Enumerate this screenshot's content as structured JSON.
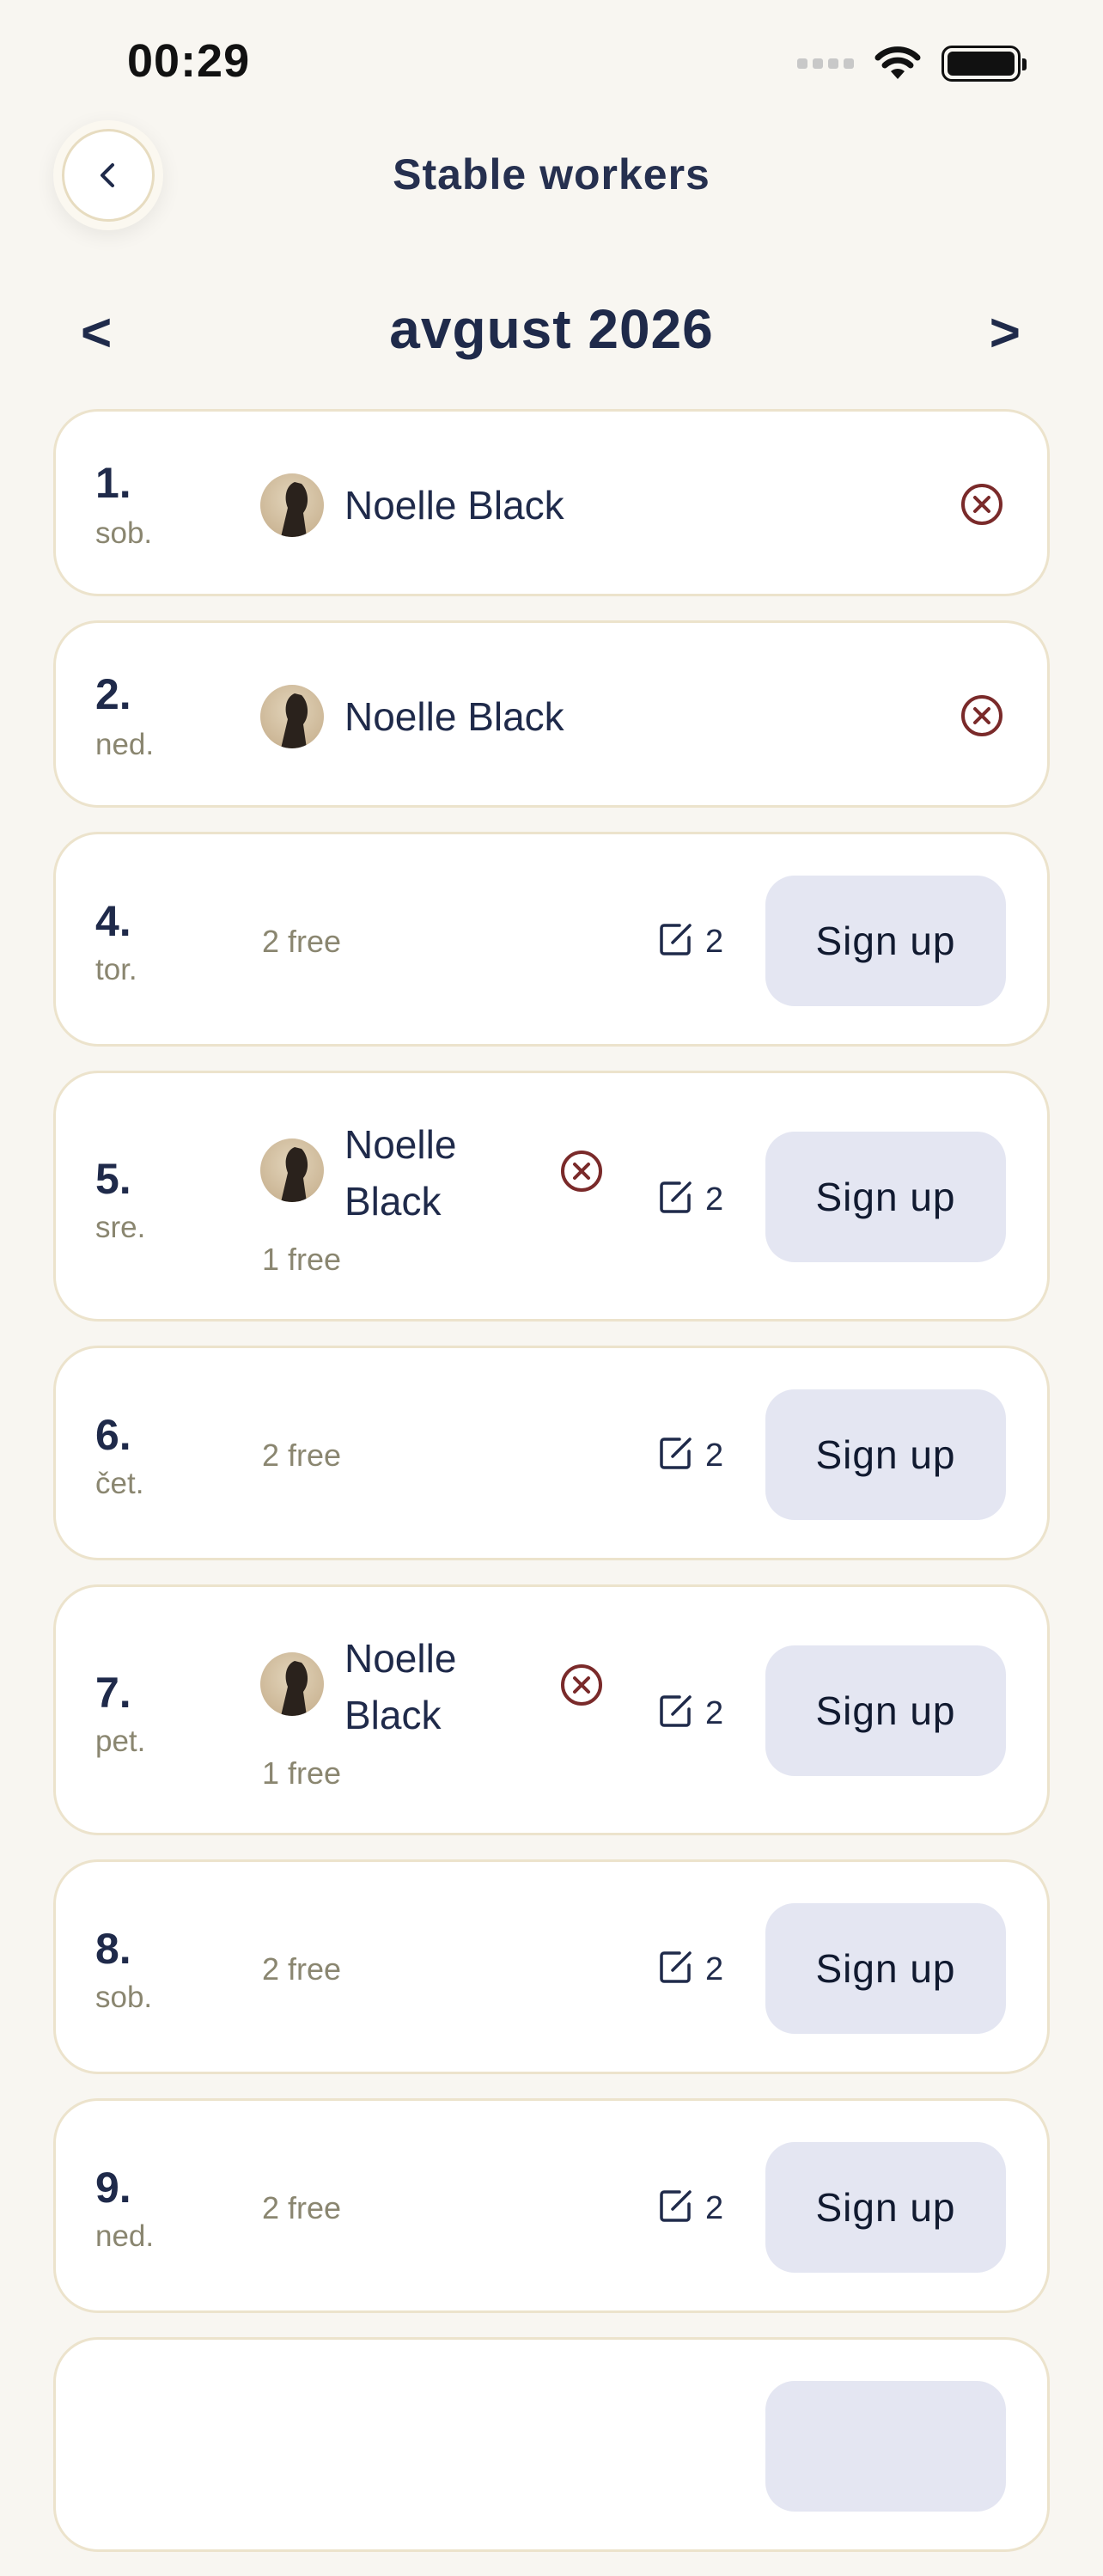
{
  "status_bar": {
    "time": "00:29"
  },
  "header": {
    "title": "Stable workers",
    "back_icon": "chevron-left-icon"
  },
  "month_nav": {
    "prev": "<",
    "label": "avgust 2026",
    "next": ">"
  },
  "days": [
    {
      "num": "1.",
      "name": "sob.",
      "worker": "Noelle Black"
    },
    {
      "num": "2.",
      "name": "ned.",
      "worker": "Noelle Black"
    },
    {
      "num": "4.",
      "name": "tor.",
      "free": "2 free",
      "slots": "2",
      "signup": "Sign up"
    },
    {
      "num": "5.",
      "name": "sre.",
      "worker_line1": "Noelle",
      "worker_line2": "Black",
      "free": "1 free",
      "slots": "2",
      "signup": "Sign up"
    },
    {
      "num": "6.",
      "name": "čet.",
      "free": "2 free",
      "slots": "2",
      "signup": "Sign up"
    },
    {
      "num": "7.",
      "name": "pet.",
      "worker_line1": "Noelle",
      "worker_line2": "Black",
      "free": "1 free",
      "slots": "2",
      "signup": "Sign up"
    },
    {
      "num": "8.",
      "name": "sob.",
      "free": "2 free",
      "slots": "2",
      "signup": "Sign up"
    },
    {
      "num": "9.",
      "name": "ned.",
      "free": "2 free",
      "slots": "2",
      "signup": "Sign up"
    }
  ],
  "colors": {
    "background": "#f8f6f1",
    "navy": "#1f2a4a",
    "remove": "#7a2a2a",
    "signup_bg": "#e4e6f2",
    "card_border": "#ece3cc"
  }
}
